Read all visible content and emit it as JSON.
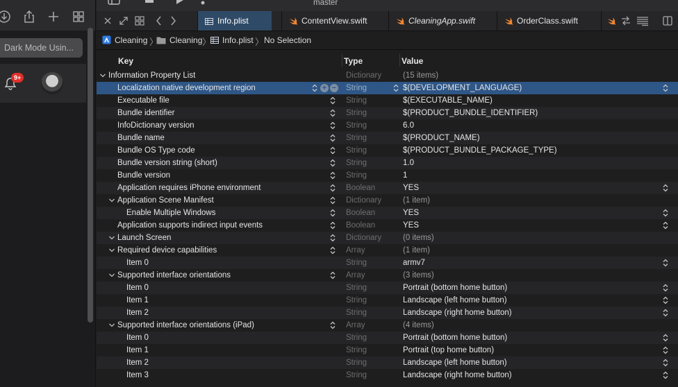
{
  "colors": {
    "accent_tab": "#2f4a66",
    "selected_row": "#2e5686",
    "badge": "#e0302b"
  },
  "left_panel": {
    "search_text": "Dark Mode Usin...",
    "notification_count": "9+"
  },
  "toolbar": {
    "branch": "master"
  },
  "tabs": [
    {
      "label": "Info.plist",
      "icon": "plist-icon",
      "active": true
    },
    {
      "label": "ContentView.swift",
      "icon": "swift-icon",
      "active": false
    },
    {
      "label": "CleaningApp.swift",
      "icon": "swift-icon",
      "active": false
    },
    {
      "label": "OrderClass.swift",
      "icon": "swift-icon",
      "active": false
    }
  ],
  "breadcrumb": [
    "Cleaning",
    "Cleaning",
    "Info.plist",
    "No Selection"
  ],
  "columns": {
    "key": "Key",
    "type": "Type",
    "value": "Value"
  },
  "rows": [
    {
      "key": "Information Property List",
      "type": "Dictionary",
      "value": "(15 items)",
      "level": 0,
      "disclosure": true,
      "stepper": false,
      "value_stepper": false,
      "muted": true
    },
    {
      "key": "Localization native development region",
      "type": "String",
      "value": "$(DEVELOPMENT_LANGUAGE)",
      "level": 1,
      "disclosure": false,
      "stepper": true,
      "value_stepper": true,
      "selected": true
    },
    {
      "key": "Executable file",
      "type": "String",
      "value": "$(EXECUTABLE_NAME)",
      "level": 1,
      "stepper": true
    },
    {
      "key": "Bundle identifier",
      "type": "String",
      "value": "$(PRODUCT_BUNDLE_IDENTIFIER)",
      "level": 1,
      "stepper": true
    },
    {
      "key": "InfoDictionary version",
      "type": "String",
      "value": "6.0",
      "level": 1,
      "stepper": true
    },
    {
      "key": "Bundle name",
      "type": "String",
      "value": "$(PRODUCT_NAME)",
      "level": 1,
      "stepper": true
    },
    {
      "key": "Bundle OS Type code",
      "type": "String",
      "value": "$(PRODUCT_BUNDLE_PACKAGE_TYPE)",
      "level": 1,
      "stepper": true
    },
    {
      "key": "Bundle version string (short)",
      "type": "String",
      "value": "1.0",
      "level": 1,
      "stepper": true
    },
    {
      "key": "Bundle version",
      "type": "String",
      "value": "1",
      "level": 1,
      "stepper": true
    },
    {
      "key": "Application requires iPhone environment",
      "type": "Boolean",
      "value": "YES",
      "level": 1,
      "stepper": true,
      "value_stepper": true
    },
    {
      "key": "Application Scene Manifest",
      "type": "Dictionary",
      "value": "(1 item)",
      "level": 1,
      "disclosure": true,
      "stepper": true,
      "muted": true
    },
    {
      "key": "Enable Multiple Windows",
      "type": "Boolean",
      "value": "YES",
      "level": 2,
      "stepper": true,
      "value_stepper": true
    },
    {
      "key": "Application supports indirect input events",
      "type": "Boolean",
      "value": "YES",
      "level": 1,
      "stepper": true,
      "value_stepper": true
    },
    {
      "key": "Launch Screen",
      "type": "Dictionary",
      "value": "(0 items)",
      "level": 1,
      "disclosure": true,
      "stepper": true,
      "muted": true
    },
    {
      "key": "Required device capabilities",
      "type": "Array",
      "value": "(1 item)",
      "level": 1,
      "disclosure": true,
      "stepper": true,
      "muted": true
    },
    {
      "key": "Item 0",
      "type": "String",
      "value": "armv7",
      "level": 2,
      "value_stepper": true
    },
    {
      "key": "Supported interface orientations",
      "type": "Array",
      "value": "(3 items)",
      "level": 1,
      "disclosure": true,
      "stepper": true,
      "muted": true
    },
    {
      "key": "Item 0",
      "type": "String",
      "value": "Portrait (bottom home button)",
      "level": 2,
      "value_stepper": true
    },
    {
      "key": "Item 1",
      "type": "String",
      "value": "Landscape (left home button)",
      "level": 2,
      "value_stepper": true
    },
    {
      "key": "Item 2",
      "type": "String",
      "value": "Landscape (right home button)",
      "level": 2,
      "value_stepper": true
    },
    {
      "key": "Supported interface orientations (iPad)",
      "type": "Array",
      "value": "(4 items)",
      "level": 1,
      "disclosure": true,
      "stepper": true,
      "muted": true
    },
    {
      "key": "Item 0",
      "type": "String",
      "value": "Portrait (bottom home button)",
      "level": 2,
      "value_stepper": true
    },
    {
      "key": "Item 1",
      "type": "String",
      "value": "Portrait (top home button)",
      "level": 2,
      "value_stepper": true
    },
    {
      "key": "Item 2",
      "type": "String",
      "value": "Landscape (left home button)",
      "level": 2,
      "value_stepper": true
    },
    {
      "key": "Item 3",
      "type": "String",
      "value": "Landscape (right home button)",
      "level": 2,
      "value_stepper": true
    }
  ]
}
